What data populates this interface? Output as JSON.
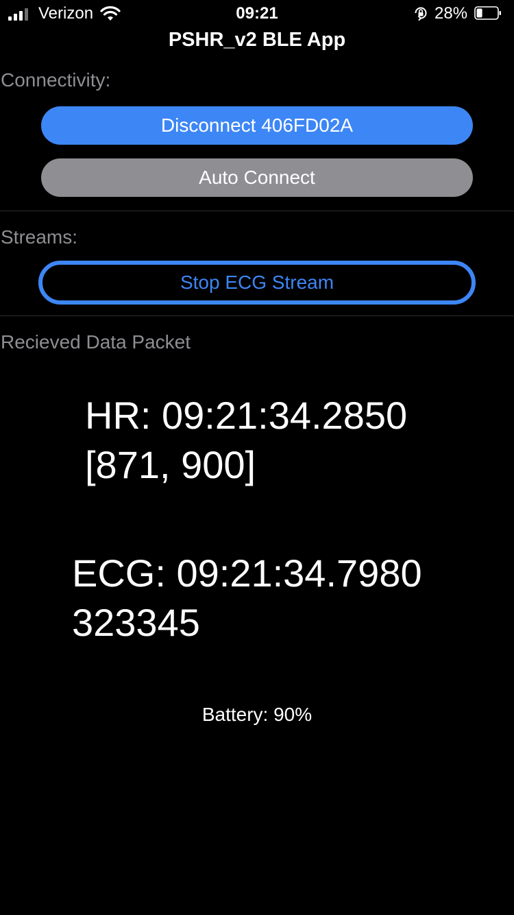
{
  "status_bar": {
    "carrier": "Verizon",
    "time": "09:21",
    "battery_percent": "28%",
    "signal_bars_filled": 3,
    "signal_bars_total": 4,
    "battery_level": 0.28,
    "icons": [
      "signal-icon",
      "wifi-icon",
      "orientation-lock-icon",
      "battery-icon"
    ]
  },
  "header": {
    "title": "PSHR_v2 BLE App"
  },
  "connectivity": {
    "label": "Connectivity:",
    "disconnect_button": "Disconnect 406FD02A",
    "auto_connect_button": "Auto Connect"
  },
  "streams": {
    "label": "Streams:",
    "stop_ecg_button": "Stop ECG Stream"
  },
  "data_packet": {
    "label": "Recieved Data Packet",
    "hr_line1": "HR: 09:21:34.2850",
    "hr_line2": "[871, 900]",
    "ecg_line1": "ECG: 09:21:34.7980",
    "ecg_line2": "323345",
    "battery": "Battery: 90%"
  },
  "colors": {
    "accent": "#3d86f5",
    "secondary_button": "#8e8e93",
    "section_label": "#8e8e93",
    "background": "#000000"
  }
}
